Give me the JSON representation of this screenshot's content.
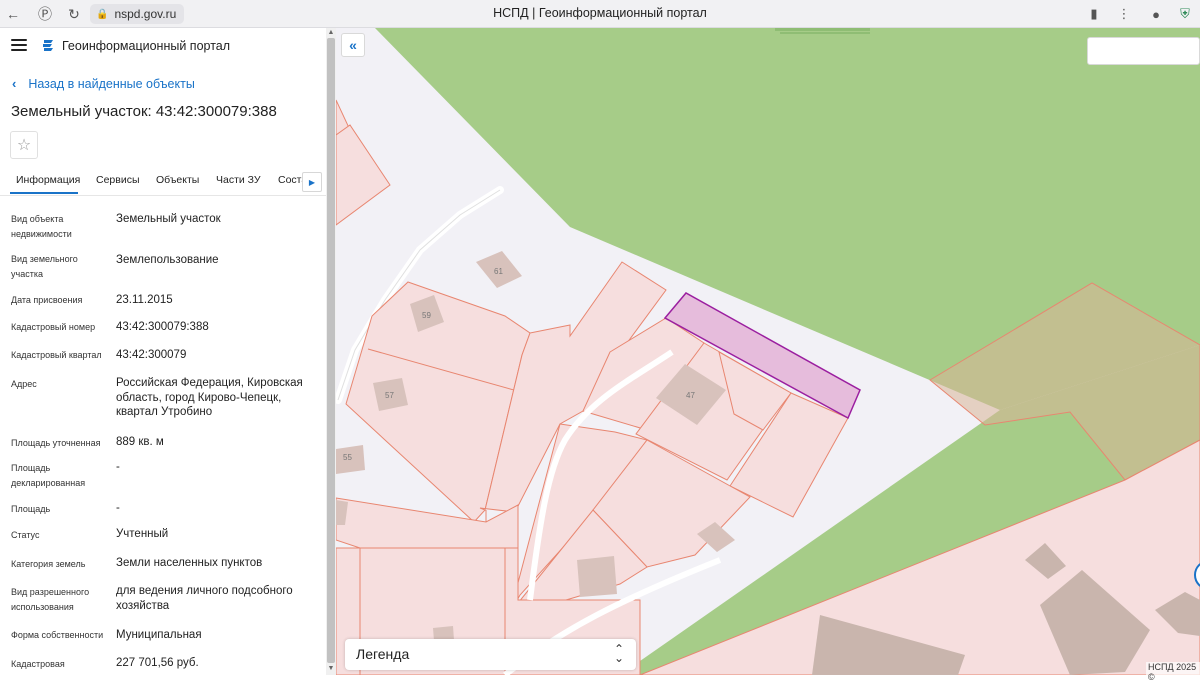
{
  "browser": {
    "url": "nspd.gov.ru",
    "page_title": "НСПД | Геоинформационный портал"
  },
  "app": {
    "title": "Геоинформационный портал",
    "back_link": "Назад в найденные объекты",
    "object_title": "Земельный участок: 43:42:300079:388"
  },
  "tabs": [
    {
      "label": "Информация",
      "active": true
    },
    {
      "label": "Сервисы",
      "active": false
    },
    {
      "label": "Объекты",
      "active": false
    },
    {
      "label": "Части ЗУ",
      "active": false
    },
    {
      "label": "Соста",
      "active": false
    }
  ],
  "fields": [
    {
      "label": "Вид объекта недвижимости",
      "value": "Земельный участок"
    },
    {
      "label": "Вид земельного участка",
      "value": "Землепользование"
    },
    {
      "label": "Дата присвоения",
      "value": "23.11.2015"
    },
    {
      "label": "Кадастровый номер",
      "value": "43:42:300079:388"
    },
    {
      "label": "Кадастровый квартал",
      "value": "43:42:300079"
    },
    {
      "label": "Адрес",
      "value": "Российская Федерация, Кировская область, город Кирово-Чепецк, квартал Утробино"
    },
    {
      "label": "Площадь уточненная",
      "value": "889 кв. м"
    },
    {
      "label": "Площадь декларированная",
      "value": "-"
    },
    {
      "label": "Площадь",
      "value": "-"
    },
    {
      "label": "Статус",
      "value": "Учтенный"
    },
    {
      "label": "Категория земель",
      "value": "Земли населенных пунктов"
    },
    {
      "label": "Вид разрешенного использования",
      "value": "для ведения личного подсобного хозяйства"
    },
    {
      "label": "Форма собственности",
      "value": "Муниципальная"
    },
    {
      "label": "Кадастровая",
      "value": "227 701,56 руб."
    }
  ],
  "map": {
    "building_labels": [
      "61",
      "59",
      "57",
      "55",
      "47"
    ],
    "legend_label": "Легенда",
    "copyright": "НСПД 2025 ©",
    "colors": {
      "green_zone": "#a6cc88",
      "parcel_fill": "#f6dede",
      "parcel_stroke": "#e88670",
      "selected_fill": "#e6bcdc",
      "selected_stroke": "#9b1fa0",
      "building": "#d8c2bc"
    }
  },
  "icons": {
    "back": "chevron-left-icon",
    "star": "star-icon",
    "collapse": "double-chevron-left-icon",
    "legend_dropdown": "updown-chevron-icon"
  }
}
